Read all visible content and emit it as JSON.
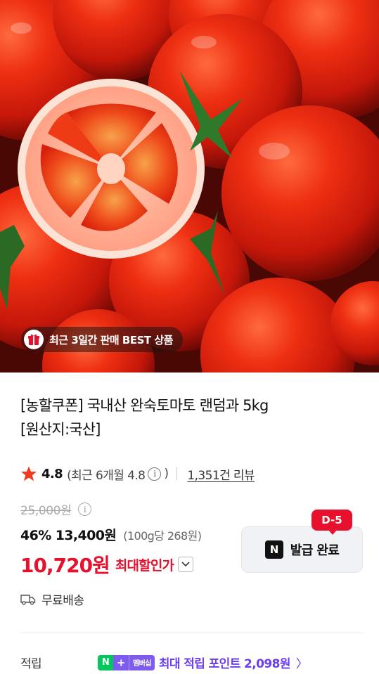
{
  "hero": {
    "badge_text": "최근 3일간 판매 BEST 상품",
    "badge_icon": "gift-icon"
  },
  "product": {
    "title_line1": "[농할쿠폰] 국내산 완숙토마토 랜덤과 5kg",
    "title_line2": "[원산지:국산]"
  },
  "rating": {
    "score": "4.8",
    "recent_prefix": "(최근 6개월 4.8",
    "recent_suffix": ")",
    "info_glyph": "i",
    "review_count": "1,351건 리뷰",
    "star_color": "#ef3b24"
  },
  "price": {
    "original": "25,000원",
    "discount_rate": "46%",
    "sale_price": "13,400원",
    "unit_price": "(100g당 268원)",
    "coupon_price": "10,720원",
    "coupon_label": "최대할인가",
    "accent_color": "#e8112d"
  },
  "coupon_button": {
    "dday": "D-5",
    "n_glyph": "N",
    "label": "발급 완료"
  },
  "shipping": {
    "label": "무료배송",
    "icon": "truck-icon"
  },
  "points": {
    "label": "적립",
    "badge_n": "N",
    "badge_plus": "+",
    "badge_member": "멤버십",
    "text": "최대 적립 포인트 2,098원",
    "chevron": "〉",
    "color": "#6b3ef0"
  }
}
